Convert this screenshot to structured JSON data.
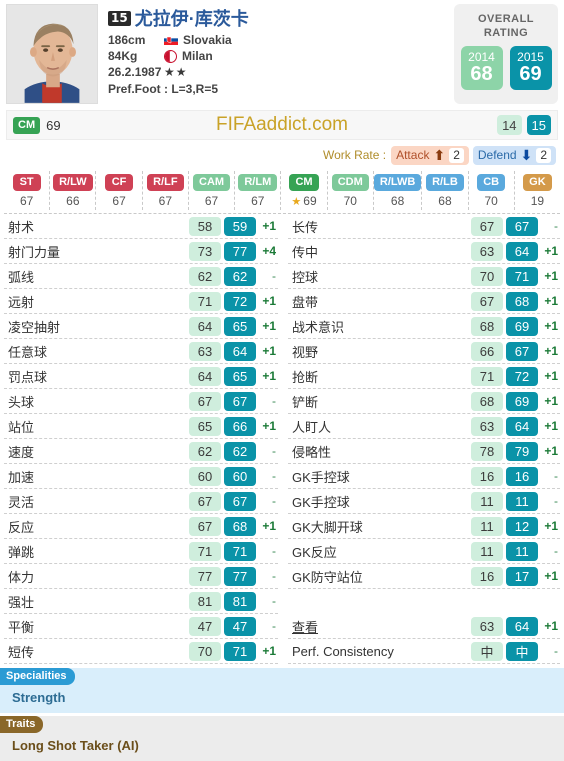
{
  "player": {
    "jersey_number": "15",
    "name": "尤拉伊·库茨卡",
    "height": "186cm",
    "weight": "84Kg",
    "birthdate": "26.2.1987",
    "nationality": "Slovakia",
    "club": "Milan",
    "star_rating": "★★",
    "preferred_foot": "Pref.Foot : L=3,R=5"
  },
  "overall": {
    "title_line1": "OVERALL",
    "title_line2": "RATING",
    "old_year": "2014",
    "old_value": "68",
    "new_year": "2015",
    "new_value": "69",
    "old_color": "#8dd4a8",
    "new_color": "#0a93a8"
  },
  "brandbar": {
    "main_position": "CM",
    "main_position_value": "69",
    "site_name": "FIFAaddict.com",
    "skill_old": "14",
    "skill_new": "15"
  },
  "work_rate": {
    "label": "Work Rate :",
    "attack_label": "Attack",
    "attack_value": "2",
    "attack_arrow": "arrow-up-icon",
    "defend_label": "Defend",
    "defend_value": "2",
    "defend_arrow": "arrow-down-icon"
  },
  "positions": [
    {
      "code": "ST",
      "value": "67",
      "color": "#cf4155",
      "starred": false
    },
    {
      "code": "R/LW",
      "value": "66",
      "color": "#cf4155",
      "starred": false
    },
    {
      "code": "CF",
      "value": "67",
      "color": "#cf4155",
      "starred": false
    },
    {
      "code": "R/LF",
      "value": "67",
      "color": "#cf4155",
      "starred": false
    },
    {
      "code": "CAM",
      "value": "67",
      "color": "#7ec99a",
      "starred": false
    },
    {
      "code": "R/LM",
      "value": "67",
      "color": "#7ec99a",
      "starred": false
    },
    {
      "code": "CM",
      "value": "69",
      "color": "#36a354",
      "starred": true
    },
    {
      "code": "CDM",
      "value": "70",
      "color": "#7ec99a",
      "starred": false
    },
    {
      "code": "R/LWB",
      "value": "68",
      "color": "#5aa9dd",
      "starred": false
    },
    {
      "code": "R/LB",
      "value": "68",
      "color": "#5aa9dd",
      "starred": false
    },
    {
      "code": "CB",
      "value": "70",
      "color": "#5aa9dd",
      "starred": false
    },
    {
      "code": "GK",
      "value": "19",
      "color": "#d49a4a",
      "starred": false
    }
  ],
  "stats_left": [
    {
      "name": "射术",
      "old": "58",
      "new": "59",
      "delta": "+1"
    },
    {
      "name": "射门力量",
      "old": "73",
      "new": "77",
      "delta": "+4"
    },
    {
      "name": "弧线",
      "old": "62",
      "new": "62",
      "delta": "-"
    },
    {
      "name": "远射",
      "old": "71",
      "new": "72",
      "delta": "+1"
    },
    {
      "name": "凌空抽射",
      "old": "64",
      "new": "65",
      "delta": "+1"
    },
    {
      "name": "任意球",
      "old": "63",
      "new": "64",
      "delta": "+1"
    },
    {
      "name": "罚点球",
      "old": "64",
      "new": "65",
      "delta": "+1"
    },
    {
      "name": "头球",
      "old": "67",
      "new": "67",
      "delta": "-"
    },
    {
      "name": "站位",
      "old": "65",
      "new": "66",
      "delta": "+1"
    },
    {
      "name": "速度",
      "old": "62",
      "new": "62",
      "delta": "-"
    },
    {
      "name": "加速",
      "old": "60",
      "new": "60",
      "delta": "-"
    },
    {
      "name": "灵活",
      "old": "67",
      "new": "67",
      "delta": "-"
    },
    {
      "name": "反应",
      "old": "67",
      "new": "68",
      "delta": "+1"
    },
    {
      "name": "弹跳",
      "old": "71",
      "new": "71",
      "delta": "-"
    },
    {
      "name": "体力",
      "old": "77",
      "new": "77",
      "delta": "-"
    },
    {
      "name": "强壮",
      "old": "81",
      "new": "81",
      "delta": "-"
    },
    {
      "name": "平衡",
      "old": "47",
      "new": "47",
      "delta": "-"
    },
    {
      "name": "短传",
      "old": "70",
      "new": "71",
      "delta": "+1"
    }
  ],
  "stats_right": [
    {
      "name": "长传",
      "old": "67",
      "new": "67",
      "delta": "-"
    },
    {
      "name": "传中",
      "old": "63",
      "new": "64",
      "delta": "+1"
    },
    {
      "name": "控球",
      "old": "70",
      "new": "71",
      "delta": "+1"
    },
    {
      "name": "盘带",
      "old": "67",
      "new": "68",
      "delta": "+1"
    },
    {
      "name": "战术意识",
      "old": "68",
      "new": "69",
      "delta": "+1"
    },
    {
      "name": "视野",
      "old": "66",
      "new": "67",
      "delta": "+1"
    },
    {
      "name": "抢断",
      "old": "71",
      "new": "72",
      "delta": "+1"
    },
    {
      "name": "铲断",
      "old": "68",
      "new": "69",
      "delta": "+1"
    },
    {
      "name": "人盯人",
      "old": "63",
      "new": "64",
      "delta": "+1"
    },
    {
      "name": "侵略性",
      "old": "78",
      "new": "79",
      "delta": "+1"
    },
    {
      "name": "GK手控球",
      "old": "16",
      "new": "16",
      "delta": "-"
    },
    {
      "name": "GK手控球",
      "old": "11",
      "new": "11",
      "delta": "-"
    },
    {
      "name": "GK大脚开球",
      "old": "11",
      "new": "12",
      "delta": "+1"
    },
    {
      "name": "GK反应",
      "old": "11",
      "new": "11",
      "delta": "-"
    },
    {
      "name": "GK防守站位",
      "old": "16",
      "new": "17",
      "delta": "+1"
    },
    {
      "name": "",
      "old": "",
      "new": "",
      "delta": ""
    },
    {
      "name": "查看",
      "old": "63",
      "new": "64",
      "delta": "+1"
    },
    {
      "name": "Perf. Consistency",
      "old": "中",
      "new": "中",
      "delta": "-"
    }
  ],
  "specialities": {
    "tag": "Specialities",
    "items": [
      "Strength"
    ]
  },
  "traits": {
    "tag": "Traits",
    "items": [
      "Long Shot Taker (AI)"
    ]
  }
}
